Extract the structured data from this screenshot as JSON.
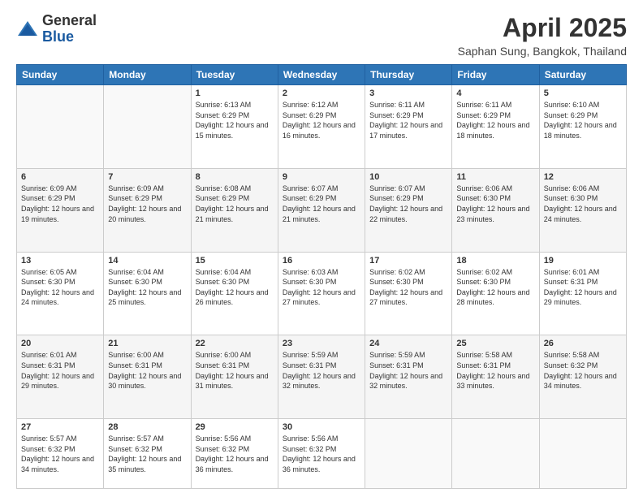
{
  "logo": {
    "general": "General",
    "blue": "Blue"
  },
  "header": {
    "title": "April 2025",
    "subtitle": "Saphan Sung, Bangkok, Thailand"
  },
  "days_of_week": [
    "Sunday",
    "Monday",
    "Tuesday",
    "Wednesday",
    "Thursday",
    "Friday",
    "Saturday"
  ],
  "weeks": [
    [
      {
        "day": "",
        "info": ""
      },
      {
        "day": "",
        "info": ""
      },
      {
        "day": "1",
        "info": "Sunrise: 6:13 AM\nSunset: 6:29 PM\nDaylight: 12 hours and 15 minutes."
      },
      {
        "day": "2",
        "info": "Sunrise: 6:12 AM\nSunset: 6:29 PM\nDaylight: 12 hours and 16 minutes."
      },
      {
        "day": "3",
        "info": "Sunrise: 6:11 AM\nSunset: 6:29 PM\nDaylight: 12 hours and 17 minutes."
      },
      {
        "day": "4",
        "info": "Sunrise: 6:11 AM\nSunset: 6:29 PM\nDaylight: 12 hours and 18 minutes."
      },
      {
        "day": "5",
        "info": "Sunrise: 6:10 AM\nSunset: 6:29 PM\nDaylight: 12 hours and 18 minutes."
      }
    ],
    [
      {
        "day": "6",
        "info": "Sunrise: 6:09 AM\nSunset: 6:29 PM\nDaylight: 12 hours and 19 minutes."
      },
      {
        "day": "7",
        "info": "Sunrise: 6:09 AM\nSunset: 6:29 PM\nDaylight: 12 hours and 20 minutes."
      },
      {
        "day": "8",
        "info": "Sunrise: 6:08 AM\nSunset: 6:29 PM\nDaylight: 12 hours and 21 minutes."
      },
      {
        "day": "9",
        "info": "Sunrise: 6:07 AM\nSunset: 6:29 PM\nDaylight: 12 hours and 21 minutes."
      },
      {
        "day": "10",
        "info": "Sunrise: 6:07 AM\nSunset: 6:29 PM\nDaylight: 12 hours and 22 minutes."
      },
      {
        "day": "11",
        "info": "Sunrise: 6:06 AM\nSunset: 6:30 PM\nDaylight: 12 hours and 23 minutes."
      },
      {
        "day": "12",
        "info": "Sunrise: 6:06 AM\nSunset: 6:30 PM\nDaylight: 12 hours and 24 minutes."
      }
    ],
    [
      {
        "day": "13",
        "info": "Sunrise: 6:05 AM\nSunset: 6:30 PM\nDaylight: 12 hours and 24 minutes."
      },
      {
        "day": "14",
        "info": "Sunrise: 6:04 AM\nSunset: 6:30 PM\nDaylight: 12 hours and 25 minutes."
      },
      {
        "day": "15",
        "info": "Sunrise: 6:04 AM\nSunset: 6:30 PM\nDaylight: 12 hours and 26 minutes."
      },
      {
        "day": "16",
        "info": "Sunrise: 6:03 AM\nSunset: 6:30 PM\nDaylight: 12 hours and 27 minutes."
      },
      {
        "day": "17",
        "info": "Sunrise: 6:02 AM\nSunset: 6:30 PM\nDaylight: 12 hours and 27 minutes."
      },
      {
        "day": "18",
        "info": "Sunrise: 6:02 AM\nSunset: 6:30 PM\nDaylight: 12 hours and 28 minutes."
      },
      {
        "day": "19",
        "info": "Sunrise: 6:01 AM\nSunset: 6:31 PM\nDaylight: 12 hours and 29 minutes."
      }
    ],
    [
      {
        "day": "20",
        "info": "Sunrise: 6:01 AM\nSunset: 6:31 PM\nDaylight: 12 hours and 29 minutes."
      },
      {
        "day": "21",
        "info": "Sunrise: 6:00 AM\nSunset: 6:31 PM\nDaylight: 12 hours and 30 minutes."
      },
      {
        "day": "22",
        "info": "Sunrise: 6:00 AM\nSunset: 6:31 PM\nDaylight: 12 hours and 31 minutes."
      },
      {
        "day": "23",
        "info": "Sunrise: 5:59 AM\nSunset: 6:31 PM\nDaylight: 12 hours and 32 minutes."
      },
      {
        "day": "24",
        "info": "Sunrise: 5:59 AM\nSunset: 6:31 PM\nDaylight: 12 hours and 32 minutes."
      },
      {
        "day": "25",
        "info": "Sunrise: 5:58 AM\nSunset: 6:31 PM\nDaylight: 12 hours and 33 minutes."
      },
      {
        "day": "26",
        "info": "Sunrise: 5:58 AM\nSunset: 6:32 PM\nDaylight: 12 hours and 34 minutes."
      }
    ],
    [
      {
        "day": "27",
        "info": "Sunrise: 5:57 AM\nSunset: 6:32 PM\nDaylight: 12 hours and 34 minutes."
      },
      {
        "day": "28",
        "info": "Sunrise: 5:57 AM\nSunset: 6:32 PM\nDaylight: 12 hours and 35 minutes."
      },
      {
        "day": "29",
        "info": "Sunrise: 5:56 AM\nSunset: 6:32 PM\nDaylight: 12 hours and 36 minutes."
      },
      {
        "day": "30",
        "info": "Sunrise: 5:56 AM\nSunset: 6:32 PM\nDaylight: 12 hours and 36 minutes."
      },
      {
        "day": "",
        "info": ""
      },
      {
        "day": "",
        "info": ""
      },
      {
        "day": "",
        "info": ""
      }
    ]
  ]
}
